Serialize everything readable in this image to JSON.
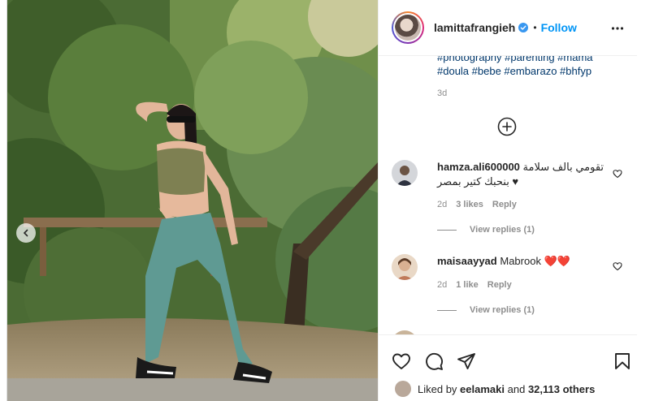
{
  "header": {
    "username": "lamittafrangieh",
    "separator": "•",
    "follow_label": "Follow"
  },
  "caption": {
    "tags_line1": "#photography #parenting #mama",
    "tags_line2": "#doula #bebe #embarazo #bhfyp",
    "time": "3d"
  },
  "comments": [
    {
      "username": "hamza.ali600000",
      "text": "تقومي بالف سلامة ♥ بنحبك كتير بمصر",
      "time": "2d",
      "likes": "3 likes",
      "reply_label": "Reply",
      "view_replies": "View replies (1)"
    },
    {
      "username": "maisaayyad",
      "text": "Mabrook ❤️❤️",
      "time": "2d",
      "likes": "1 like",
      "reply_label": "Reply",
      "view_replies": "View replies (1)"
    }
  ],
  "footer": {
    "liked_by_prefix": "Liked by",
    "liked_by_user": "eelamaki",
    "liked_by_and": "and",
    "liked_by_count": "32,113 others"
  },
  "icons": {
    "verified": "verified-badge-icon",
    "more": "more-options-icon",
    "load_more": "plus-circle-icon",
    "heart": "heart-icon",
    "comment": "comment-icon",
    "share": "paper-plane-icon",
    "save": "bookmark-icon",
    "carousel": "chevron-left-icon"
  },
  "colors": {
    "link_blue": "#0095f6",
    "hashtag": "#00376b",
    "muted": "#8e8e8e",
    "text": "#262626",
    "verified": "#3897f0"
  }
}
